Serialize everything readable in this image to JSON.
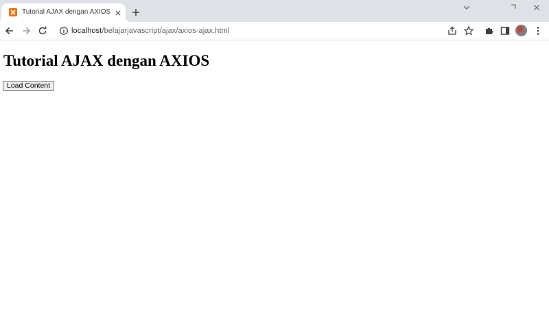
{
  "browser": {
    "tab": {
      "title": "Tutorial AJAX dengan AXIOS"
    },
    "address_bar": {
      "host": "localhost",
      "path": "/belajarjavascript/ajax/axios-ajax.html"
    }
  },
  "page": {
    "heading": "Tutorial AJAX dengan AXIOS",
    "load_button_label": "Load Content"
  }
}
